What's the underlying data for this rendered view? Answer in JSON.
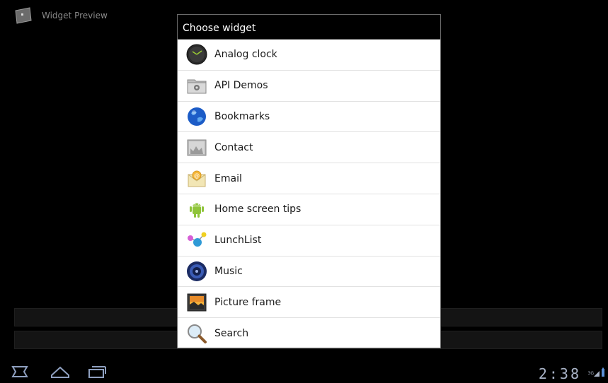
{
  "app": {
    "title": "Widget Preview"
  },
  "dialog": {
    "title": "Choose widget",
    "items": [
      {
        "label": "Analog clock",
        "icon": "analog-clock-icon"
      },
      {
        "label": "API Demos",
        "icon": "api-demos-icon"
      },
      {
        "label": "Bookmarks",
        "icon": "bookmarks-globe-icon"
      },
      {
        "label": "Contact",
        "icon": "contact-icon"
      },
      {
        "label": "Email",
        "icon": "email-icon"
      },
      {
        "label": "Home screen tips",
        "icon": "android-icon"
      },
      {
        "label": "LunchList",
        "icon": "lunchlist-icon"
      },
      {
        "label": "Music",
        "icon": "music-speaker-icon"
      },
      {
        "label": "Picture frame",
        "icon": "picture-frame-icon"
      },
      {
        "label": "Search",
        "icon": "search-icon"
      }
    ]
  },
  "status_bar": {
    "time": "2:38",
    "network": "3G",
    "nav": [
      "back-icon",
      "home-icon",
      "recent-apps-icon"
    ]
  }
}
